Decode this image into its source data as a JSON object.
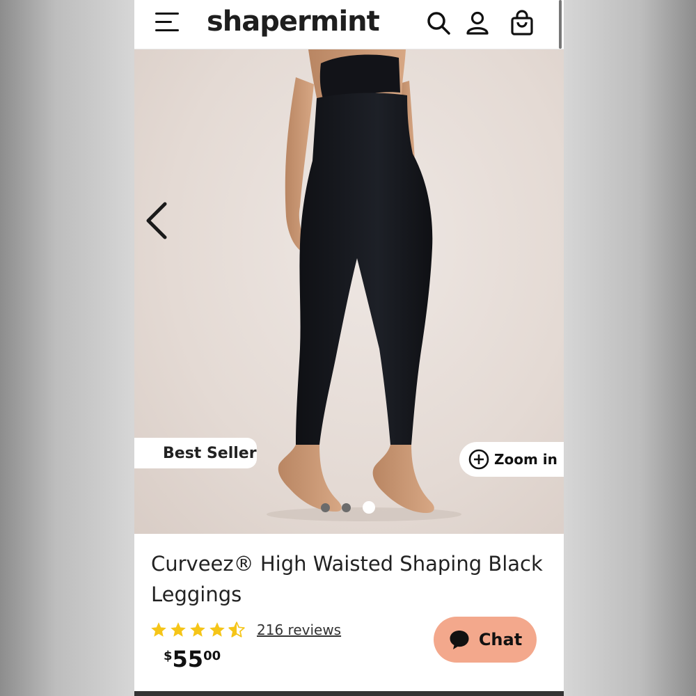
{
  "header": {
    "logo": "shapermint",
    "icons": [
      "menu-icon",
      "search-icon",
      "account-icon",
      "shopping-bag-icon"
    ]
  },
  "hero": {
    "badge": "Best Seller",
    "zoom_label": "Zoom in",
    "carousel": {
      "total": 3,
      "active": 3
    }
  },
  "product": {
    "title": "Curveez® High Waisted Shaping Black Leggings",
    "rating": 4.5,
    "reviews": "216 reviews",
    "price_currency": "$",
    "price_dollars": "55",
    "price_cents": "00"
  },
  "chat": {
    "label": "Chat"
  },
  "colors": {
    "star": "#f5c518",
    "chat_bg": "#f3a88c",
    "hero_bg": "#e6ddd7",
    "leggings": "#15171c"
  }
}
